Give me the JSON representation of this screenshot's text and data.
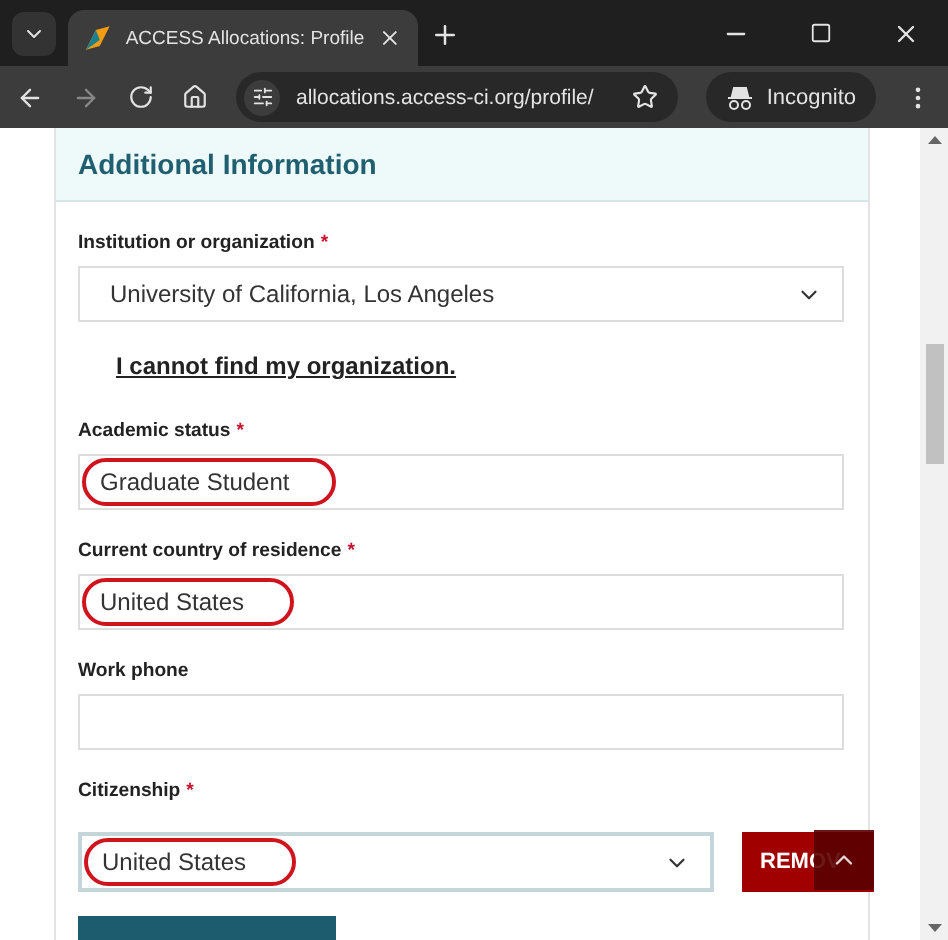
{
  "browser": {
    "tab": {
      "title": "ACCESS Allocations: Profile",
      "selected": true
    },
    "url": "allocations.access-ci.org/profile/",
    "profile": "Incognito"
  },
  "section": {
    "title": "Additional Information"
  },
  "institution": {
    "label": "Institution or organization",
    "required_mark": "*",
    "value": "University of California, Los Angeles",
    "highlighted": false
  },
  "org_link": "I cannot find my organization.",
  "fields": [
    {
      "label": "Academic status",
      "required_mark": "*",
      "value": "Graduate Student",
      "highlighted": true
    },
    {
      "label": "Current country of residence",
      "required_mark": "*",
      "value": "United States",
      "highlighted": true
    },
    {
      "label": "Work phone",
      "highlighted": false
    }
  ],
  "citizenship": {
    "label": "Citizenship",
    "required_mark": "*",
    "value": "United States",
    "highlighted": true,
    "remove_button": "REMOV"
  }
}
